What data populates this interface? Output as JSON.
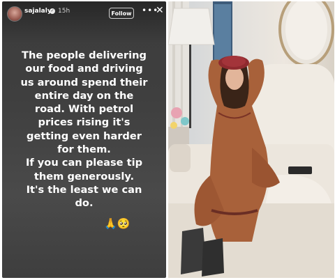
{
  "story": {
    "username": "sajalaly",
    "verified_mark": "✓",
    "time": "15h",
    "follow_label": "Follow",
    "more_label": "•••",
    "close_label": "✕",
    "message_lines": [
      "The people delivering",
      "our food and driving",
      "us around spend their",
      "entire day on the",
      "road. With petrol",
      "prices rising it's",
      "getting even harder",
      "for them.",
      "If you can please tip",
      "them generously.",
      "It's the least we can",
      "do."
    ],
    "emojis": "🙏🥺"
  },
  "photo": {
    "subject": "woman-in-brown-dress-on-sofa"
  },
  "colors": {
    "story_bg": "#3f3f3f",
    "dress": "#a8613a",
    "beret": "#8f2a2f",
    "sofa": "#ece7df"
  }
}
